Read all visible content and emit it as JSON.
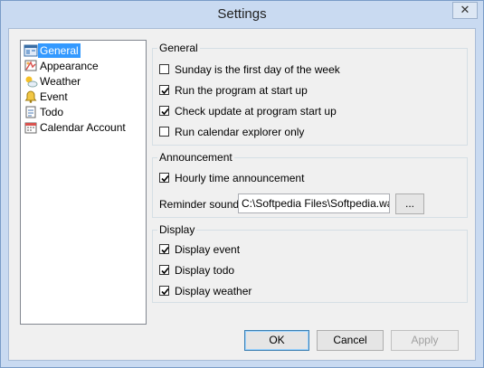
{
  "window": {
    "title": "Settings",
    "close_glyph": "✕"
  },
  "sidebar": {
    "items": [
      {
        "label": "General",
        "icon": "general-settings-icon",
        "selected": true
      },
      {
        "label": "Appearance",
        "icon": "appearance-icon",
        "selected": false
      },
      {
        "label": "Weather",
        "icon": "weather-icon",
        "selected": false
      },
      {
        "label": "Event",
        "icon": "event-icon",
        "selected": false
      },
      {
        "label": "Todo",
        "icon": "todo-icon",
        "selected": false
      },
      {
        "label": "Calendar Account",
        "icon": "calendar-account-icon",
        "selected": false
      }
    ]
  },
  "general": {
    "title": "General",
    "options": [
      {
        "label": "Sunday is the first day of the week",
        "checked": false
      },
      {
        "label": "Run the program at start up",
        "checked": true
      },
      {
        "label": "Check update at program start up",
        "checked": true
      },
      {
        "label": "Run calendar explorer only",
        "checked": false
      }
    ]
  },
  "announcement": {
    "title": "Announcement",
    "hourly": {
      "label": "Hourly time announcement",
      "checked": true
    },
    "reminder_label": "Reminder sound",
    "reminder_value": "C:\\Softpedia Files\\Softpedia.wav",
    "browse_label": "..."
  },
  "display": {
    "title": "Display",
    "options": [
      {
        "label": "Display event",
        "checked": true
      },
      {
        "label": "Display todo",
        "checked": true
      },
      {
        "label": "Display weather",
        "checked": true
      }
    ]
  },
  "buttons": {
    "ok": "OK",
    "cancel": "Cancel",
    "apply": "Apply"
  }
}
